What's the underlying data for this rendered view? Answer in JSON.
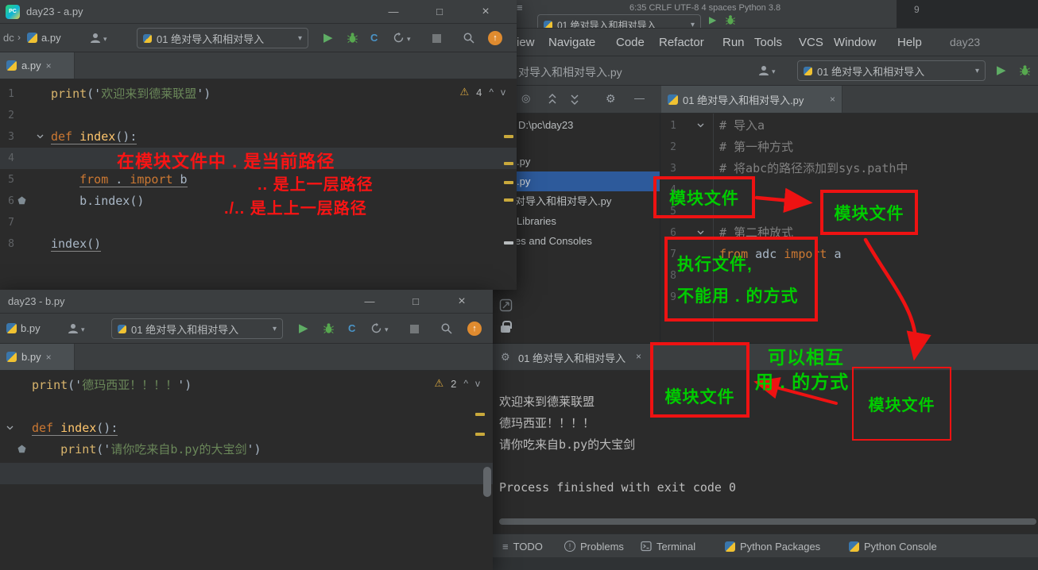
{
  "colors": {
    "annotation_red": "#ee1212",
    "annotation_green": "#00cc00",
    "selection_blue": "#2d5a9b",
    "keyword_orange": "#cc7832",
    "string_green": "#6a8759",
    "run_green": "#5fad65"
  },
  "icons": {
    "logo": "PC",
    "min": "—",
    "max": "□",
    "close": "×",
    "dd": "▾",
    "play": "▶",
    "stop": "■",
    "up": "↑",
    "warn": "⚠",
    "chev_up": "^",
    "chev_down": "v",
    "crumb_sep": "›",
    "menu_lines": "≡",
    "gear": "⚙",
    "target": "◎",
    "minus": "—",
    "cov": "C",
    "excl": "!"
  },
  "wa": {
    "title": "day23 - a.py",
    "crumb1": "dc",
    "crumb2": "a.py",
    "runcfg": "01 绝对导入和相对导入",
    "tab": "a.py",
    "warn": "4",
    "nums": [
      "1",
      "2",
      "3",
      "4",
      "5",
      "6",
      "7",
      "8"
    ],
    "code": {
      "l1": [
        "print",
        "('",
        "欢迎来到德莱联盟",
        "')"
      ],
      "l3": [
        "def ",
        "index",
        "():"
      ],
      "l5": [
        "    ",
        "from",
        " . ",
        "import",
        " b"
      ],
      "l6": "    b.index()",
      "l8": "index()"
    }
  },
  "wb": {
    "title": "day23 - b.py",
    "crumb": "b.py",
    "runcfg": "01 绝对导入和相对导入",
    "tab": "b.py",
    "warn": "2",
    "code": {
      "l1": [
        "print",
        "('",
        "德玛西亚！！！！",
        "')"
      ],
      "l3": [
        "def ",
        "index",
        "():"
      ],
      "l4": [
        "    ",
        "print",
        "('",
        "请你吃来自b.py的大宝剑",
        "')"
      ]
    }
  },
  "mw": {
    "status_top": "6:35   CRLF   UTF-8   4 spaces   Python 3.8",
    "corner": "9",
    "menu": [
      "iew",
      "Navigate",
      "Code",
      "Refactor",
      "Run",
      "Tools",
      "VCS",
      "Window",
      "Help"
    ],
    "project": "day23",
    "crumb": "对导入和相对导入.py",
    "runcfg": "01 绝对导入和相对导入",
    "topcfg": "01 绝对导入和相对导入",
    "tree": {
      "root": "D:\\pc\\day23",
      "r1": ".py",
      "r2": ".py",
      "r3": "对导入和相对导入.py",
      "r4": "Libraries",
      "r5": "es and Consoles"
    },
    "tab": "01 绝对导入和相对导入.py",
    "nums": [
      "1",
      "2",
      "3",
      "4",
      "5",
      "6",
      "7",
      "8",
      "9"
    ],
    "code": {
      "l1": "# 导入a",
      "l2": "# 第一种方式",
      "l3": "# 将abc的路径添加到sys.path中",
      "l6": "# 第二种放式",
      "l7": [
        "from",
        " adc ",
        "import",
        " a"
      ]
    },
    "console": {
      "tab": "01 绝对导入和相对导入",
      "o1": "欢迎来到德莱联盟",
      "o2": "德玛西亚！！！！",
      "o3": "请你吃来自b.py的大宝剑",
      "o4": "Process finished with exit code 0"
    },
    "tools": [
      "TODO",
      "Problems",
      "Terminal",
      "Python Packages",
      "Python Console"
    ]
  },
  "ann": {
    "red1": "在模块文件中 . 是当前路径",
    "red2": ".. 是上一层路径",
    "red3": "./.. 是上上一层路径",
    "box_a": "模块文件",
    "box_b": "模块文件",
    "box_c1": "执行文件,",
    "box_c2": "不能用 . 的方式",
    "box_d": "模块文件",
    "box_e": "模块文件",
    "green1": "可以相互",
    "green2": "用 . 的方式"
  }
}
